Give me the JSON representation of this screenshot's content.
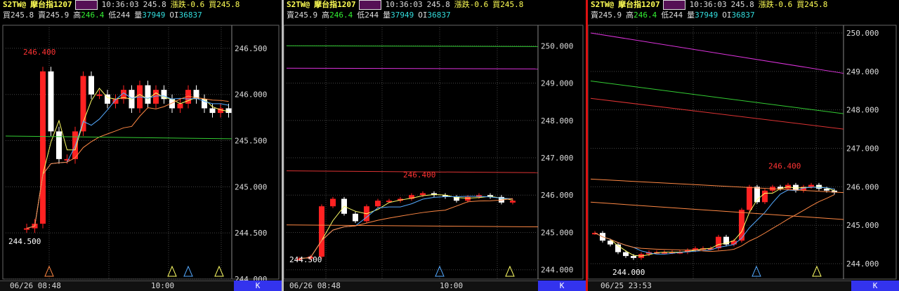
{
  "panels": [
    {
      "symbol": "S2TW@",
      "name": "摩台指1207",
      "time": "10:36:03",
      "price": "245.8",
      "change": "漲跌-0.6",
      "last": "買245.8",
      "bid_label": "買245.8",
      "ask_label": "賣245.9",
      "high_label": "高",
      "high": "246.4",
      "low_label": "低244",
      "vol_label": "量",
      "vol": "37949",
      "oi_label": "OI",
      "oi": "36837",
      "y_ticks": [
        "246.500",
        "246.000",
        "245.500",
        "245.000",
        "244.500",
        "244.000"
      ],
      "hi_marker": "246.400",
      "lo_marker": "244.500",
      "date": "06/26 08:48",
      "time_tick": "10:00",
      "k_label": "K"
    },
    {
      "symbol": "S2TW@",
      "name": "摩台指1207",
      "time": "10:36:03",
      "price": "245.8",
      "change": "漲跌-0.6",
      "last": "買245.8",
      "bid_label": "賣245.9",
      "ask_label": "",
      "high_label": "高",
      "high": "246.4",
      "low_label": "低244",
      "vol_label": "量",
      "vol": "37949",
      "oi_label": "OI",
      "oi": "36837",
      "y_ticks": [
        "250.000",
        "249.000",
        "248.000",
        "247.000",
        "246.000",
        "245.000",
        "244.000"
      ],
      "hi_marker": "246.400",
      "lo_marker": "244.500",
      "date": "06/26 08:48",
      "time_tick": "10:00",
      "k_label": "K"
    },
    {
      "symbol": "S2TW@",
      "name": "摩台指1207",
      "time": "10:36:03",
      "price": "245.8",
      "change": "漲跌-0.6",
      "last": "買245.8",
      "bid_label": "賣245.9",
      "ask_label": "",
      "high_label": "高",
      "high": "246.4",
      "low_label": "低244",
      "vol_label": "量",
      "vol": "37949",
      "oi_label": "OI",
      "oi": "36837",
      "y_ticks": [
        "250.000",
        "249.000",
        "248.000",
        "247.000",
        "246.000",
        "245.000",
        "244.000"
      ],
      "hi_marker": "246.400",
      "lo_marker": "244.000",
      "date": "06/25 23:53",
      "time_tick": "",
      "k_label": "K"
    }
  ],
  "colors": {
    "up": "#ff2222",
    "down": "#ffffff",
    "grid": "#444444",
    "ma_fast": "#ffff66",
    "ma_mid": "#55aaff",
    "ma_slow": "#ff8844",
    "ma_green": "#33cc33",
    "ma_red": "#dd3333",
    "ma_magenta": "#dd33dd"
  }
}
